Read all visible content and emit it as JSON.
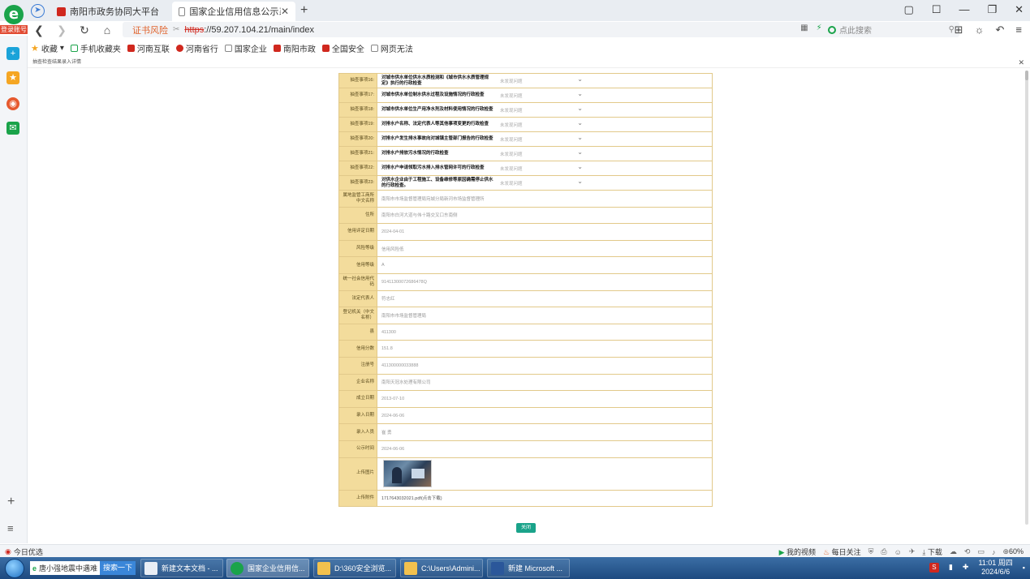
{
  "browser": {
    "login_badge": "登录账号",
    "tabs": [
      {
        "title": "南阳市政务协同大平台"
      },
      {
        "title": "国家企业信用信息公示系统(河南",
        "active": true
      }
    ],
    "address": {
      "cert_warning": "证书风险",
      "scheme": "https",
      "rest": "://59.207.104.21/main/index"
    },
    "search_placeholder": "点此搜索",
    "bookmarks": [
      {
        "label": "收藏"
      },
      {
        "label": "手机收藏夹"
      },
      {
        "label": "河南互联"
      },
      {
        "label": "河南省行"
      },
      {
        "label": "国家企业"
      },
      {
        "label": "南阳市政"
      },
      {
        "label": "全国安全"
      },
      {
        "label": "网页无法"
      }
    ],
    "notice": "抽查检查结果录入详情"
  },
  "matters": [
    {
      "label": "抽查事项16:",
      "text": "对城市供水单位供水水质检测和《城市供水水质管理规定》执行的行政检查",
      "select": "未发现问题"
    },
    {
      "label": "抽查事项17:",
      "text": "对城市供水单位制水供水过程及设施情况的行政检查",
      "select": "未发现问题"
    },
    {
      "label": "抽查事项18:",
      "text": "对城市供水单位生产用净水剂及材料使用情况的行政检查",
      "select": "未发现问题"
    },
    {
      "label": "抽查事项19:",
      "text": "对排水户名称、法定代表人等其他事项变更的行政检查",
      "select": "未发现问题"
    },
    {
      "label": "抽查事项20:",
      "text": "对排水户发生排水事故向对城镇主管部门报告的行政检查",
      "select": "未发现问题"
    },
    {
      "label": "抽查事项21:",
      "text": "对排水户排放污水情况的行政检查",
      "select": "未发现问题"
    },
    {
      "label": "抽查事项22:",
      "text": "对排水户申请领取污水排入排水管网许可的行政检查",
      "select": "未发现问题"
    },
    {
      "label": "抽查事项23:",
      "text": "对供水企业由于工程施工、设备维修等原因确需停止供水的行政检查。",
      "select": "未发现问题"
    }
  ],
  "info": [
    {
      "label": "属地监管工商所中文名称",
      "value": "南阳市市场监督管理局宛城分局新河市场监督管理所"
    },
    {
      "label": "住所",
      "value": "南阳市白河大道与伟十路交叉口东南侧"
    },
    {
      "label": "信用评定日期",
      "value": "2024-04-01"
    },
    {
      "label": "风险等级",
      "value": "信用风险低"
    },
    {
      "label": "信用等级",
      "value": "A"
    },
    {
      "label": "统一社会信用代码",
      "value": "91411300072686478Q"
    },
    {
      "label": "法定代表人",
      "value": "符志红"
    },
    {
      "label": "登记机关（中文名称）",
      "value": "南阳市市场监督管理局"
    },
    {
      "label": "县",
      "value": "411300"
    },
    {
      "label": "信用分数",
      "value": "151.8"
    },
    {
      "label": "注册号",
      "value": "411300000033888"
    },
    {
      "label": "企业名称",
      "value": "南阳天冠水处理有限公司"
    },
    {
      "label": "成立日期",
      "value": "2013-07-10"
    },
    {
      "label": "录入日期",
      "value": "2024-06-06"
    },
    {
      "label": "录入人员",
      "value": "崔 勇"
    },
    {
      "label": "公示时间",
      "value": "2024-06-06"
    }
  ],
  "upload": {
    "photo_label": "上传图片",
    "file_label": "上传附件",
    "file_name": "1717643032021.pdf(点击下载)"
  },
  "close_button": "关闭",
  "statusbar": {
    "left": "今日优选",
    "items": [
      "我的视频",
      "每日关注",
      "下载"
    ],
    "zoom": "60%"
  },
  "taskbar": {
    "search_text": "唐小强地震中遇难",
    "search_button": "搜索一下",
    "items": [
      {
        "label": "新建文本文档 - ..."
      },
      {
        "label": "国家企业信用信..."
      },
      {
        "label": "D:\\360安全浏览..."
      },
      {
        "label": "C:\\Users\\Admini..."
      },
      {
        "label": "新建 Microsoft ..."
      }
    ],
    "time": "11:01 周四",
    "date": "2024/6/6"
  }
}
